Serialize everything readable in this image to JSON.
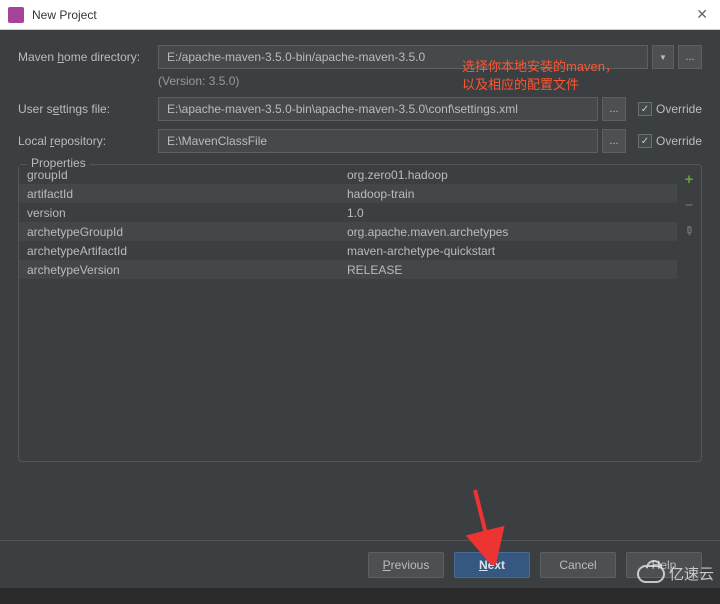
{
  "window": {
    "title": "New Project"
  },
  "fields": {
    "mavenHome": {
      "label_pre": "Maven ",
      "label_u": "h",
      "label_post": "ome directory:",
      "value": "E:/apache-maven-3.5.0-bin/apache-maven-3.5.0"
    },
    "version": "(Version: 3.5.0)",
    "userSettings": {
      "label_pre": "User s",
      "label_u": "e",
      "label_post": "ttings file:",
      "value": "E:\\apache-maven-3.5.0-bin\\apache-maven-3.5.0\\conf\\settings.xml",
      "override": "Override",
      "checked": "✓"
    },
    "localRepo": {
      "label_pre": "Local ",
      "label_u": "r",
      "label_post": "epository:",
      "value": "E:\\MavenClassFile",
      "override": "Override",
      "checked": "✓"
    }
  },
  "annotation": {
    "line1": "选择你本地安装的maven，",
    "line2": "以及相应的配置文件"
  },
  "properties": {
    "legend": "Properties",
    "rows": [
      {
        "key": "groupId",
        "value": "org.zero01.hadoop"
      },
      {
        "key": "artifactId",
        "value": "hadoop-train"
      },
      {
        "key": "version",
        "value": "1.0"
      },
      {
        "key": "archetypeGroupId",
        "value": "org.apache.maven.archetypes"
      },
      {
        "key": "archetypeArtifactId",
        "value": "maven-archetype-quickstart"
      },
      {
        "key": "archetypeVersion",
        "value": "RELEASE"
      }
    ]
  },
  "buttons": {
    "previous": {
      "u": "P",
      "rest": "revious"
    },
    "next": {
      "u": "N",
      "rest": "ext"
    },
    "cancel": "Cancel",
    "help": "Help"
  },
  "watermark": "亿速云"
}
